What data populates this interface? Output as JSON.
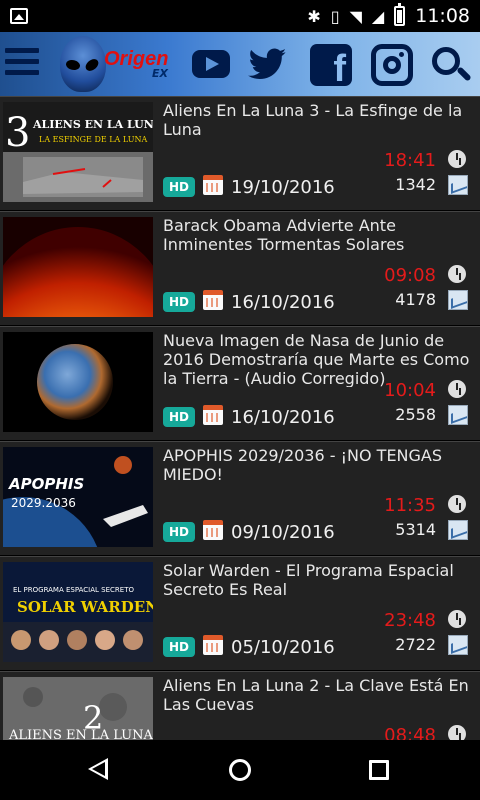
{
  "status_bar": {
    "time": "11:08"
  },
  "app": {
    "brand": "Origen",
    "brand_sub": "EX"
  },
  "badges": {
    "hd": "HD"
  },
  "videos": [
    {
      "title": "Aliens En La Luna 3 - La Esfinge de la Luna",
      "date": "19/10/2016",
      "duration": "18:41",
      "views": "1342",
      "thumb_text": [
        "3",
        "ALIENS EN LA LUNA",
        "LA ESFINGE DE LA LUNA"
      ]
    },
    {
      "title": "Barack Obama Advierte Ante Inminentes Tormentas Solares",
      "date": "16/10/2016",
      "duration": "09:08",
      "views": "4178",
      "thumb_text": []
    },
    {
      "title": "Nueva Imagen de Nasa de Junio de 2016 Demostraría que Marte es Como la Tierra - (Audio Corregido)",
      "date": "16/10/2016",
      "duration": "10:04",
      "views": "2558",
      "thumb_text": []
    },
    {
      "title": "APOPHIS 2029/2036 - ¡NO TENGAS MIEDO!",
      "date": "09/10/2016",
      "duration": "11:35",
      "views": "5314",
      "thumb_text": [
        "APOPHIS",
        "2029.2036"
      ]
    },
    {
      "title": "Solar Warden - El Programa Espacial Secreto Es Real",
      "date": "05/10/2016",
      "duration": "23:48",
      "views": "2722",
      "thumb_text": [
        "EL PROGRAMA ESPACIAL SECRETO",
        "SOLAR WARDEN"
      ]
    },
    {
      "title": "Aliens En La Luna 2 - La Clave Está En Las Cuevas",
      "date": "",
      "duration": "08:48",
      "views": "",
      "thumb_text": [
        "ALIENS EN LA LUNA",
        "2"
      ]
    }
  ],
  "colors": {
    "appbar_start": "#1f4f8f",
    "appbar_end": "#a9cdf0",
    "hd_badge": "#16a99a",
    "duration": "#e41b1b",
    "row_bg": "#222222"
  }
}
